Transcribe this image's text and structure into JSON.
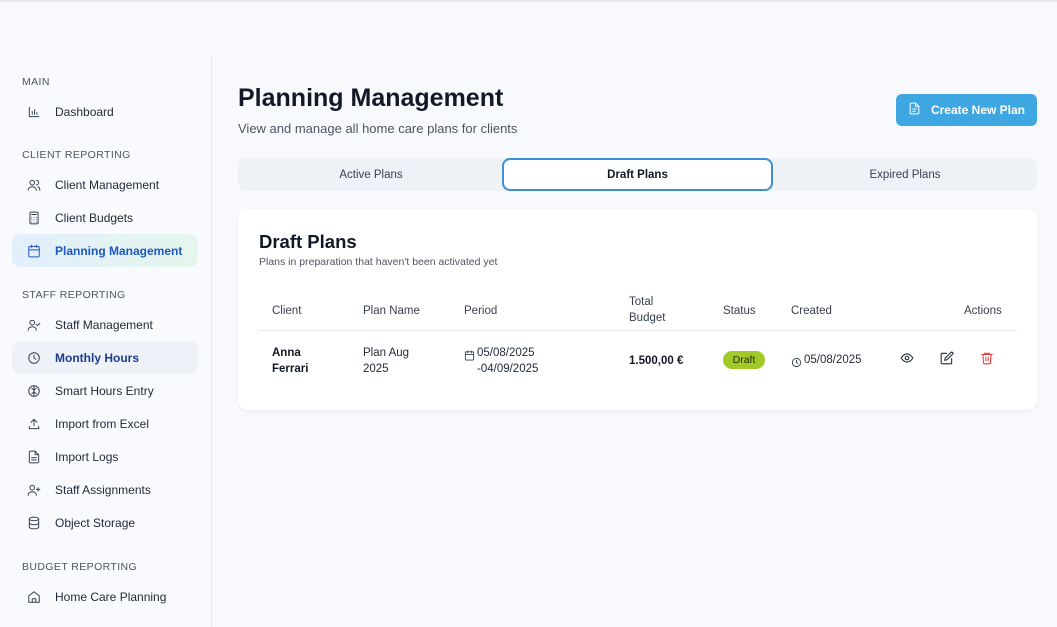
{
  "sidebar": {
    "sections": [
      {
        "title": "MAIN",
        "items": [
          {
            "label": "Dashboard",
            "icon": "bar-chart-icon"
          }
        ]
      },
      {
        "title": "CLIENT REPORTING",
        "items": [
          {
            "label": "Client Management",
            "icon": "users-icon"
          },
          {
            "label": "Client Budgets",
            "icon": "calculator-icon"
          },
          {
            "label": "Planning Management",
            "icon": "calendar-icon"
          }
        ]
      },
      {
        "title": "STAFF REPORTING",
        "items": [
          {
            "label": "Staff Management",
            "icon": "user-check-icon"
          },
          {
            "label": "Monthly Hours",
            "icon": "clock-icon"
          },
          {
            "label": "Smart Hours Entry",
            "icon": "brain-icon"
          },
          {
            "label": "Import from Excel",
            "icon": "upload-icon"
          },
          {
            "label": "Import Logs",
            "icon": "file-text-icon"
          },
          {
            "label": "Staff Assignments",
            "icon": "user-plus-icon"
          },
          {
            "label": "Object Storage",
            "icon": "database-icon"
          }
        ]
      },
      {
        "title": "BUDGET REPORTING",
        "items": [
          {
            "label": "Home Care Planning",
            "icon": "home-icon"
          }
        ]
      }
    ]
  },
  "header": {
    "title": "Planning Management",
    "subtitle": "View and manage all home care plans for clients",
    "create_button": "Create New Plan"
  },
  "tabs": [
    "Active Plans",
    "Draft Plans",
    "Expired Plans"
  ],
  "card": {
    "title": "Draft Plans",
    "subtitle": "Plans in preparation that haven't been activated yet"
  },
  "table": {
    "headers": {
      "client": "Client",
      "plan_name": "Plan Name",
      "period": "Period",
      "budget_1": "Total",
      "budget_2": "Budget",
      "status": "Status",
      "created": "Created",
      "actions": "Actions"
    },
    "rows": [
      {
        "client_1": "Anna",
        "client_2": "Ferrari",
        "plan_1": "Plan Aug",
        "plan_2": "2025",
        "period_1": "05/08/2025",
        "period_2": "-04/09/2025",
        "budget": "1.500,00 €",
        "status": "Draft",
        "created": "05/08/2025"
      }
    ]
  },
  "colors": {
    "accent": "#3ea6e0",
    "active_nav": "#1e56c4",
    "draft_badge": "#a3c928",
    "delete": "#e53935"
  }
}
